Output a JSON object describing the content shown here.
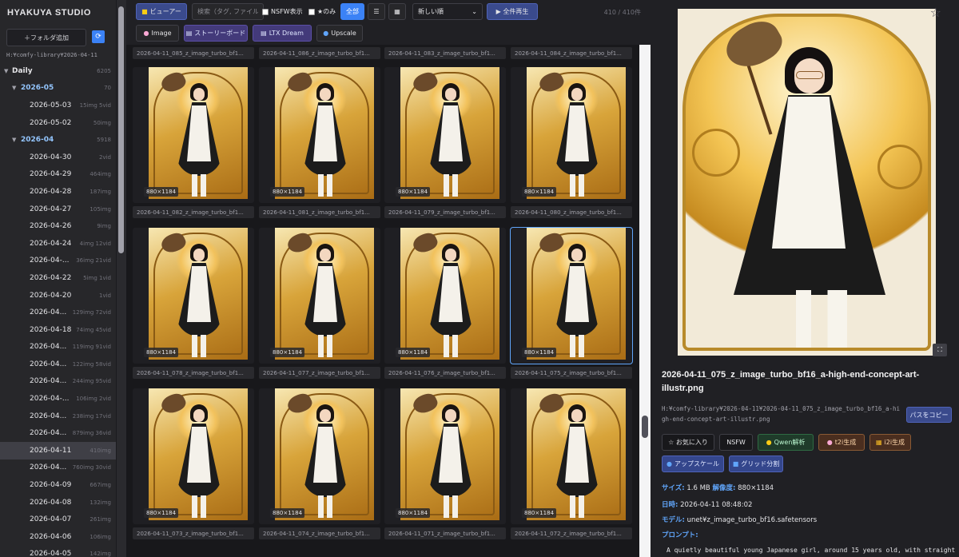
{
  "sidebar": {
    "brand": "HYAKUYA STUDIO",
    "add_folder_label": "＋フォルダ追加",
    "current_path": "H:¥comfy-library¥2026-04-11",
    "tree": [
      {
        "level": 0,
        "caret": "▼",
        "label": "Daily",
        "count": "6205",
        "selected": false
      },
      {
        "level": 1,
        "caret": "▼",
        "label": "2026-05",
        "count": "70",
        "selected": false
      },
      {
        "level": 2,
        "caret": "",
        "label": "2026-05-03",
        "count": "15img 5vid",
        "selected": false
      },
      {
        "level": 2,
        "caret": "",
        "label": "2026-05-02",
        "count": "50img",
        "selected": false
      },
      {
        "level": 1,
        "caret": "▼",
        "label": "2026-04",
        "count": "5918",
        "selected": false
      },
      {
        "level": 2,
        "caret": "",
        "label": "2026-04-30",
        "count": "2vid",
        "selected": false
      },
      {
        "level": 2,
        "caret": "",
        "label": "2026-04-29",
        "count": "464img",
        "selected": false
      },
      {
        "level": 2,
        "caret": "",
        "label": "2026-04-28",
        "count": "187img",
        "selected": false
      },
      {
        "level": 2,
        "caret": "",
        "label": "2026-04-27",
        "count": "105img",
        "selected": false
      },
      {
        "level": 2,
        "caret": "",
        "label": "2026-04-26",
        "count": "9img",
        "selected": false
      },
      {
        "level": 2,
        "caret": "",
        "label": "2026-04-24",
        "count": "4img 12vid",
        "selected": false
      },
      {
        "level": 2,
        "caret": "",
        "label": "2026-04-...",
        "count": "36img 21vid",
        "selected": false
      },
      {
        "level": 2,
        "caret": "",
        "label": "2026-04-22",
        "count": "5img 1vid",
        "selected": false
      },
      {
        "level": 2,
        "caret": "",
        "label": "2026-04-20",
        "count": "1vid",
        "selected": false
      },
      {
        "level": 2,
        "caret": "",
        "label": "2026-04...",
        "count": "129img 72vid",
        "selected": false
      },
      {
        "level": 2,
        "caret": "",
        "label": "2026-04-18",
        "count": "74img 45vid",
        "selected": false
      },
      {
        "level": 2,
        "caret": "",
        "label": "2026-04...",
        "count": "119img 91vid",
        "selected": false
      },
      {
        "level": 2,
        "caret": "",
        "label": "2026-04...",
        "count": "122img 58vid",
        "selected": false
      },
      {
        "level": 2,
        "caret": "",
        "label": "2026-04...",
        "count": "244img 95vid",
        "selected": false
      },
      {
        "level": 2,
        "caret": "",
        "label": "2026-04-...",
        "count": "106img 2vid",
        "selected": false
      },
      {
        "level": 2,
        "caret": "",
        "label": "2026-04...",
        "count": "238img 17vid",
        "selected": false
      },
      {
        "level": 2,
        "caret": "",
        "label": "2026-04...",
        "count": "879img 36vid",
        "selected": false
      },
      {
        "level": 2,
        "caret": "",
        "label": "2026-04-11",
        "count": "410img",
        "selected": true
      },
      {
        "level": 2,
        "caret": "",
        "label": "2026-04...",
        "count": "760img 30vid",
        "selected": false
      },
      {
        "level": 2,
        "caret": "",
        "label": "2026-04-09",
        "count": "667img",
        "selected": false
      },
      {
        "level": 2,
        "caret": "",
        "label": "2026-04-08",
        "count": "132img",
        "selected": false
      },
      {
        "level": 2,
        "caret": "",
        "label": "2026-04-07",
        "count": "261img",
        "selected": false
      },
      {
        "level": 2,
        "caret": "",
        "label": "2026-04-06",
        "count": "106img",
        "selected": false
      },
      {
        "level": 2,
        "caret": "",
        "label": "2026-04-05",
        "count": "142img",
        "selected": false
      }
    ]
  },
  "toolbar": {
    "viewer_label": "ビューアー",
    "search_placeholder": "検索（タグ, ファイル",
    "nsfw_label": "NSFW表示",
    "fav_only_label": "★のみ",
    "all_label": "全部",
    "sort_value": "新しい順",
    "play_all_label": "▶ 全件再生",
    "count_label": "410 / 410件",
    "image_label": "Image",
    "storyboard_label": "ストーリーボード",
    "ltx_label": "LTX Dream",
    "upscale_label": "Upscale"
  },
  "grid": {
    "top_names": [
      "2026-04-11_085_z_image_turbo_bf1...",
      "2026-04-11_086_z_image_turbo_bf1...",
      "2026-04-11_083_z_image_turbo_bf1...",
      "2026-04-11_084_z_image_turbo_bf1..."
    ],
    "rows": [
      {
        "names": [
          "2026-04-11_082_z_image_turbo_bf1...",
          "2026-04-11_081_z_image_turbo_bf1...",
          "2026-04-11_079_z_image_turbo_bf1...",
          "2026-04-11_080_z_image_turbo_bf1..."
        ]
      },
      {
        "names": [
          "2026-04-11_078_z_image_turbo_bf1...",
          "2026-04-11_077_z_image_turbo_bf1...",
          "2026-04-11_076_z_image_turbo_bf1...",
          "2026-04-11_075_z_image_turbo_bf1..."
        ]
      },
      {
        "names": [
          "2026-04-11_073_z_image_turbo_bf1...",
          "2026-04-11_074_z_image_turbo_bf1...",
          "2026-04-11_071_z_image_turbo_bf1...",
          "2026-04-11_072_z_image_turbo_bf1..."
        ]
      }
    ],
    "dims_label": "880×1184"
  },
  "detail": {
    "filename": "2026-04-11_075_z_image_turbo_bf16_a-high-end-concept-art-illustr.png",
    "path": "H:¥comfy-library¥2026-04-11¥2026-04-11_075_z_image_turbo_bf16_a-high-end-concept-art-illustr.png",
    "copy_path_label": "パスをコピー",
    "fav_label": "☆ お気に入り",
    "nsfw_label": "NSFW",
    "qwen_label": "Qwen解析",
    "t2i_label": "t2i生成",
    "i2i_label": "i2i生成",
    "upscale_label": "アップスケール",
    "grid_split_label": "グリッド分割",
    "size_key": "サイズ:",
    "size_val": "1.6 MB",
    "res_key": "解像度:",
    "res_val": "880×1184",
    "date_key": "日時:",
    "date_val": "2026-04-11 08:48:02",
    "model_key": "モデル:",
    "model_val": "unet¥z_image_turbo_bf16.safetensors",
    "prompt_key": "プロンプト:",
    "prompt_text": "A quietly beautiful young Japanese girl, around 15 years old, with straight"
  }
}
